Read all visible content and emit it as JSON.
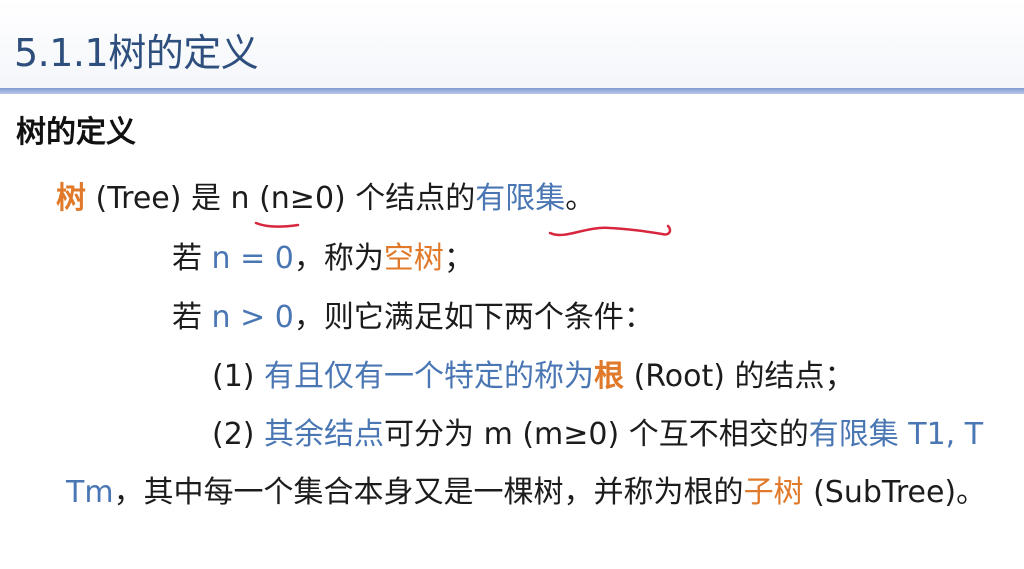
{
  "slide": {
    "title": "5.1.1树的定义",
    "heading": "树的定义"
  },
  "lines": {
    "l1": {
      "term": "树",
      "a": " (Tree) 是 ",
      "n": "n",
      "b": " (n≥0) 个结点的",
      "finite": "有限集",
      "end": "。"
    },
    "l2": {
      "a": "若 ",
      "cond": "n = 0",
      "b": "，称为",
      "empty": "空树",
      "c": "；"
    },
    "l3": {
      "a": "若 ",
      "cond": "n > 0",
      "b": "，则它满足如下两个条件："
    },
    "l4": {
      "num": "(1)  ",
      "a": "有且仅有一个特定的称为",
      "root": "根",
      "b": " (Root) 的结点；"
    },
    "l5": {
      "num": "(2)  ",
      "a": "其余结点",
      "b": "可分为 m (m≥0) 个互不相交的",
      "finite": "有限集",
      "c": " T1, T"
    },
    "l6": {
      "tm": "Tm",
      "a": "，其中每一个集合本身又是一棵树，并称为根的",
      "subtree": "子树",
      "b": " (SubTree)。"
    }
  },
  "colors": {
    "title": "#2e4f7d",
    "blue": "#4a77b4",
    "orange": "#e07a2a",
    "annotation": "#d7263d"
  }
}
